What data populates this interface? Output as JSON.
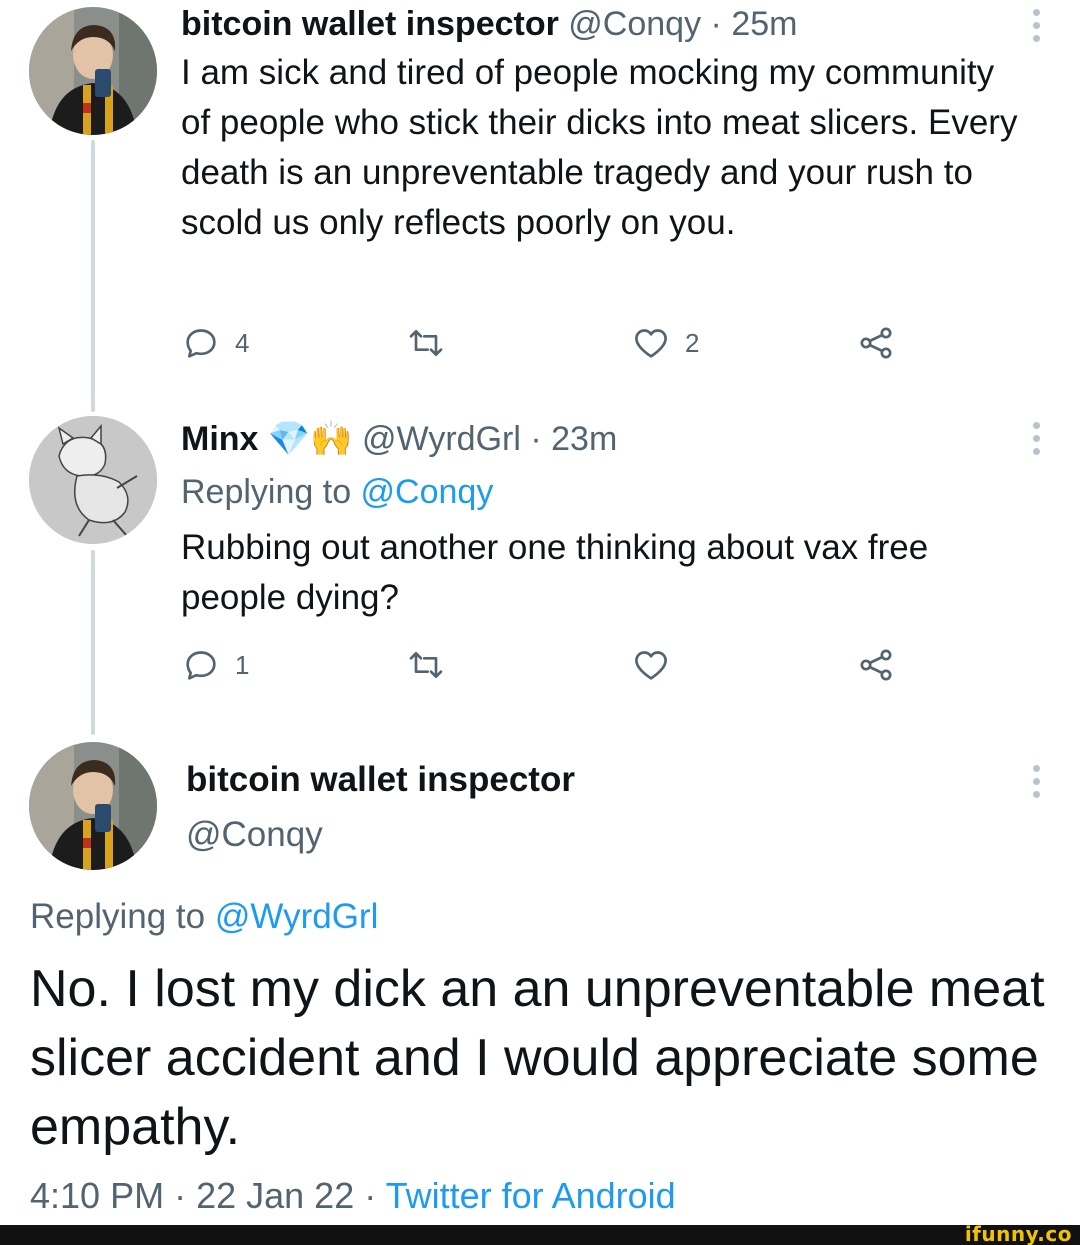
{
  "tweet1": {
    "name": "bitcoin wallet inspector",
    "handle": "@Conqy",
    "sep": " · ",
    "time": "25m",
    "text": "I am sick and tired of people mocking my community of people who stick their dicks into meat slicers. Every death is an unpreventable tragedy and your rush to scold us only reflects poorly on you.",
    "reply_count": "4",
    "like_count": "2"
  },
  "tweet2": {
    "name": "Minx",
    "emoji": "💎🙌",
    "handle": "@WyrdGrl",
    "sep": " · ",
    "time": "23m",
    "replying_prefix": "Replying to ",
    "replying_handle": "@Conqy",
    "text": "Rubbing out another one thinking about vax free people dying?",
    "reply_count": "1",
    "like_count": ""
  },
  "main_tweet": {
    "name": "bitcoin wallet inspector",
    "handle": "@Conqy",
    "replying_prefix": "Replying to ",
    "replying_handle": "@WyrdGrl",
    "text": "No. I lost my dick an an unpreventable meat slicer accident and I would appreciate some empathy.",
    "time": "4:10 PM",
    "sep": " · ",
    "date": "22 Jan 22",
    "sep2": " · ",
    "source": "Twitter for Android"
  },
  "watermark": "ifunny.co",
  "icons": {
    "reply": "reply-icon",
    "retweet": "retweet-icon",
    "like": "heart-icon",
    "share": "share-icon",
    "more": "more-options-icon"
  },
  "colors": {
    "link": "#1d9bf0",
    "secondary_text": "#536471",
    "thread_line": "#cfd9de",
    "footer_bg": "#111111",
    "watermark": "#f3c300"
  }
}
